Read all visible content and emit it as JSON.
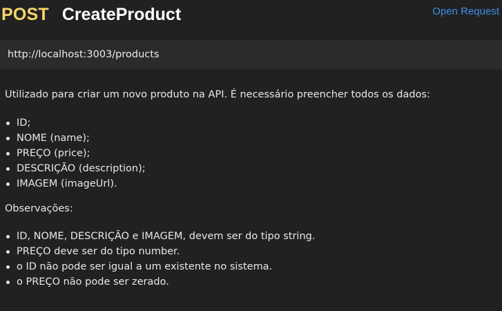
{
  "header": {
    "method": "POST",
    "request_name": "CreateProduct",
    "open_request_label": "Open Request"
  },
  "url": "http://localhost:3003/products",
  "description": "Utilizado para criar um novo produto na API. É necessário preencher todos os dados:",
  "fields": [
    "ID;",
    "NOME (name);",
    "PREÇO (price);",
    "DESCRIÇÃO (description);",
    "IMAGEM (imageUrl)."
  ],
  "observations_title": "Observações:",
  "observations": [
    "ID, NOME, DESCRIÇÃO e IMAGEM, devem ser do tipo string.",
    "PREÇO deve ser do tipo number.",
    "o ID não pode ser igual a um existente no sistema.",
    "o PREÇO não pode ser zerado."
  ],
  "colors": {
    "background": "#212121",
    "method": "#f6d66b",
    "link": "#3d8eea",
    "url_bar": "#2b2b2b"
  }
}
